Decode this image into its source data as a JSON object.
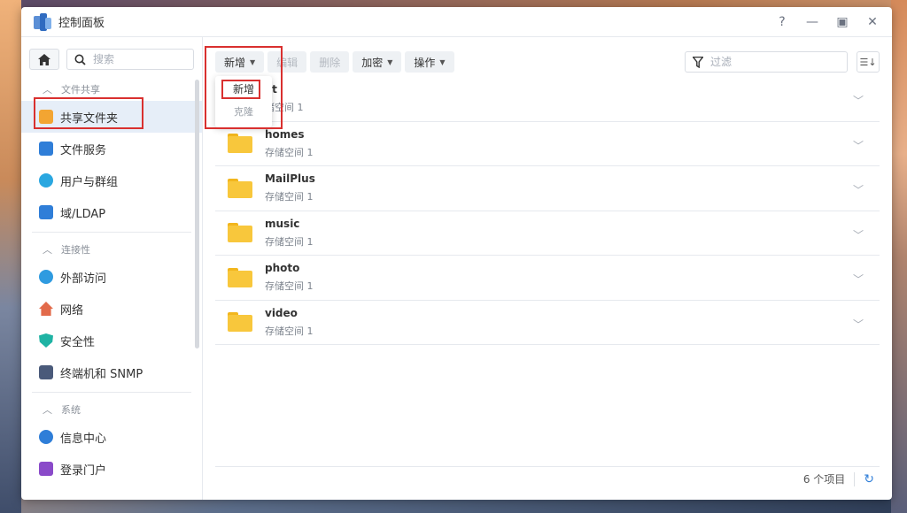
{
  "window": {
    "title": "控制面板",
    "controls": [
      "?",
      "—",
      "▣",
      "✕"
    ]
  },
  "sidebar": {
    "search_placeholder": "搜索",
    "sections": [
      {
        "label": "文件共享",
        "items": [
          {
            "label": "共享文件夹",
            "icon": "shared-folder-icon",
            "color": "#f3a532"
          },
          {
            "label": "文件服务",
            "icon": "file-services-icon",
            "color": "#2f7ed8"
          },
          {
            "label": "用户与群组",
            "icon": "users-icon",
            "color": "#2aa7e0"
          },
          {
            "label": "域/LDAP",
            "icon": "ldap-icon",
            "color": "#2f7ed8"
          }
        ]
      },
      {
        "label": "连接性",
        "items": [
          {
            "label": "外部访问",
            "icon": "external-access-icon",
            "color": "#2f9be0"
          },
          {
            "label": "网络",
            "icon": "network-icon",
            "color": "#e26a4a"
          },
          {
            "label": "安全性",
            "icon": "security-shield-icon",
            "color": "#1fb3a4"
          },
          {
            "label": "终端机和 SNMP",
            "icon": "terminal-icon",
            "color": "#4a5a7a"
          }
        ]
      },
      {
        "label": "系统",
        "items": [
          {
            "label": "信息中心",
            "icon": "info-center-icon",
            "color": "#2f7ed8"
          },
          {
            "label": "登录门户",
            "icon": "login-portal-icon",
            "color": "#8a4ac9"
          }
        ]
      }
    ]
  },
  "toolbar": {
    "new_label": "新增",
    "edit_label": "编辑",
    "delete_label": "删除",
    "encrypt_label": "加密",
    "action_label": "操作",
    "filter_placeholder": "过滤"
  },
  "dropdown": {
    "new_item": "新增",
    "clone_item": "克隆"
  },
  "rows": [
    {
      "name": "at",
      "sub": "储空间 1"
    },
    {
      "name": "homes",
      "sub": "存储空间 1"
    },
    {
      "name": "MailPlus",
      "sub": "存储空间 1"
    },
    {
      "name": "music",
      "sub": "存储空间 1"
    },
    {
      "name": "photo",
      "sub": "存储空间 1"
    },
    {
      "name": "video",
      "sub": "存储空间 1"
    }
  ],
  "footer": {
    "count": "6 个项目"
  }
}
